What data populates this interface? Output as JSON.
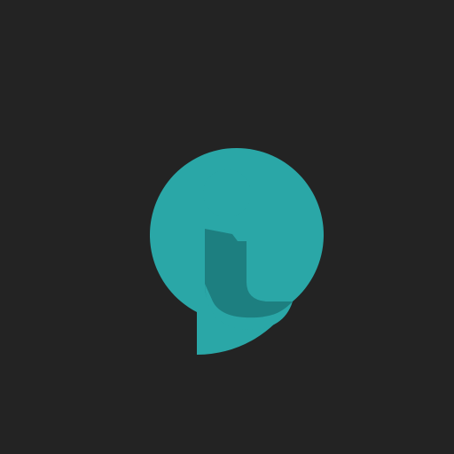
{
  "app": {
    "icon": "info-letter-i-logo-icon"
  },
  "colors": {
    "background": "#232323",
    "primary": "#2aa7a7",
    "shadow": "#1d7f80"
  }
}
